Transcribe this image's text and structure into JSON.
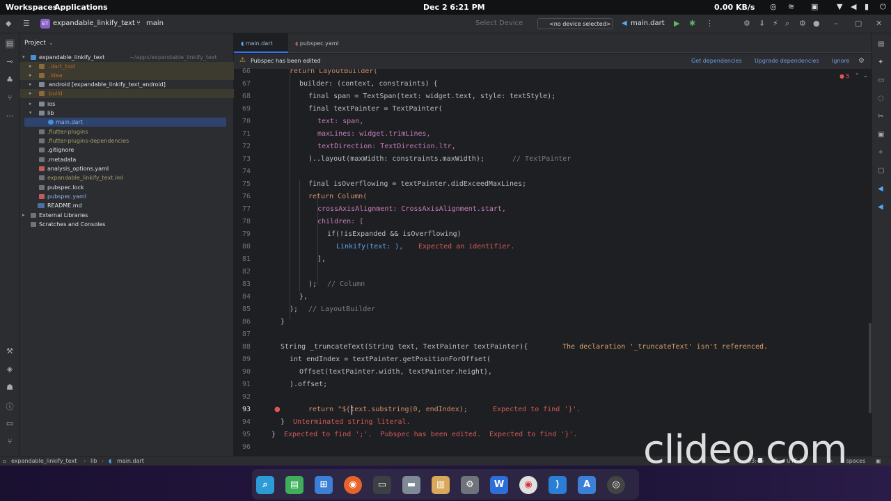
{
  "system_bar": {
    "workspaces": "Workspaces",
    "applications": "Applications",
    "datetime": "Dec 2  6:21 PM",
    "network": "0.00 KB/s"
  },
  "toolbar": {
    "project_badge": "ET",
    "project_name": "expandable_linkify_text",
    "branch": "main",
    "select_device": "Select Device",
    "no_device": "<no device selected>",
    "run_config": "main.dart"
  },
  "project_pane": {
    "header": "Project",
    "root_name": "expandable_linkify_text",
    "root_path": "~/apps/expandable_linkify_text",
    "items": [
      {
        "label": ".dart_tool",
        "color": "#b06a30"
      },
      {
        "label": ".idea",
        "color": "#b06a30"
      },
      {
        "label": "android [expandable_linkify_text_android]",
        "color": "#dfe1e5"
      },
      {
        "label": "build",
        "color": "#b06a30"
      },
      {
        "label": "ios",
        "color": "#dfe1e5"
      },
      {
        "label": "lib",
        "color": "#dfe1e5"
      },
      {
        "label": "main.dart",
        "color": "#8fb4e8"
      },
      {
        "label": ".flutter-plugins",
        "color": "#a8a06a"
      },
      {
        "label": ".flutter-plugins-dependencies",
        "color": "#a8a06a"
      },
      {
        "label": ".gitignore",
        "color": "#dfe1e5"
      },
      {
        "label": ".metadata",
        "color": "#dfe1e5"
      },
      {
        "label": "analysis_options.yaml",
        "color": "#dfe1e5"
      },
      {
        "label": "expandable_linkify_text.iml",
        "color": "#a8a06a"
      },
      {
        "label": "pubspec.lock",
        "color": "#dfe1e5"
      },
      {
        "label": "pubspec.yaml",
        "color": "#8fb4e8"
      },
      {
        "label": "README.md",
        "color": "#dfe1e5"
      },
      {
        "label": "External Libraries",
        "color": "#dfe1e5"
      },
      {
        "label": "Scratches and Consoles",
        "color": "#dfe1e5"
      }
    ]
  },
  "tabs": [
    {
      "label": "main.dart",
      "active": true
    },
    {
      "label": "pubspec.yaml",
      "active": false
    }
  ],
  "notification": {
    "text": "Pubspec has been edited",
    "get_deps": "Get dependencies",
    "upgrade_deps": "Upgrade dependencies",
    "ignore": "Ignore"
  },
  "inspection": {
    "errors": "5"
  },
  "line_numbers": [
    "66",
    "67",
    "68",
    "69",
    "70",
    "71",
    "72",
    "73",
    "74",
    "75",
    "76",
    "77",
    "78",
    "79",
    "80",
    "81",
    "82",
    "83",
    "84",
    "85",
    "86",
    "87",
    "88",
    "89",
    "90",
    "91",
    "92",
    "93",
    "94",
    "95",
    "96"
  ],
  "code_text": {
    "l66": "return LayoutBuilder(",
    "l67a": "builder: (context, constraints) {",
    "l68": "final span = TextSpan(text: widget.text, style: textStyle);",
    "l69": "final textPainter = TextPainter(",
    "l70": "text: span,",
    "l71": "maxLines: widget.trimLines,",
    "l72": "textDirection: TextDirection.ltr,",
    "l73": ")..layout(maxWidth: constraints.maxWidth);",
    "l73c": "// TextPainter",
    "l75": "final isOverflowing = textPainter.didExceedMaxLines;",
    "l76": "return Column(",
    "l77": "crossAxisAlignment: CrossAxisAlignment.start,",
    "l78": "children: [",
    "l79": "if(!isExpanded && isOverflowing)",
    "l80": "Linkify(text: ),",
    "l80e": "Expected an identifier.",
    "l81": "],",
    "l83": ");",
    "l83c": "// Column",
    "l84": "},",
    "l85": ");",
    "l85c": "// LayoutBuilder",
    "l86": "}",
    "l88": "String _truncateText(String text, TextPainter textPainter){",
    "l88w": "The declaration '_truncateText' isn't referenced.",
    "l89": "int endIndex = textPainter.getPositionForOffset(",
    "l90": "Offset(textPainter.width, textPainter.height),",
    "l91": ").offset;",
    "l93": "return \"${text.substring(0, endIndex);",
    "l93e": "Expected to find '}'.",
    "l94": "}",
    "l94e": "Unterminated string literal.",
    "l95": "}",
    "l95e": "Expected to find ';'.  Pubspec has been edited.  Expected to find '}'."
  },
  "status_bar": {
    "crumb1": "expandable_linkify_text",
    "crumb2": "lib",
    "crumb3": "main.dart",
    "position": "93:46",
    "line_sep": "LF",
    "encoding": "UTF-8",
    "indent": "2 spaces"
  },
  "watermark": "clideo.com"
}
